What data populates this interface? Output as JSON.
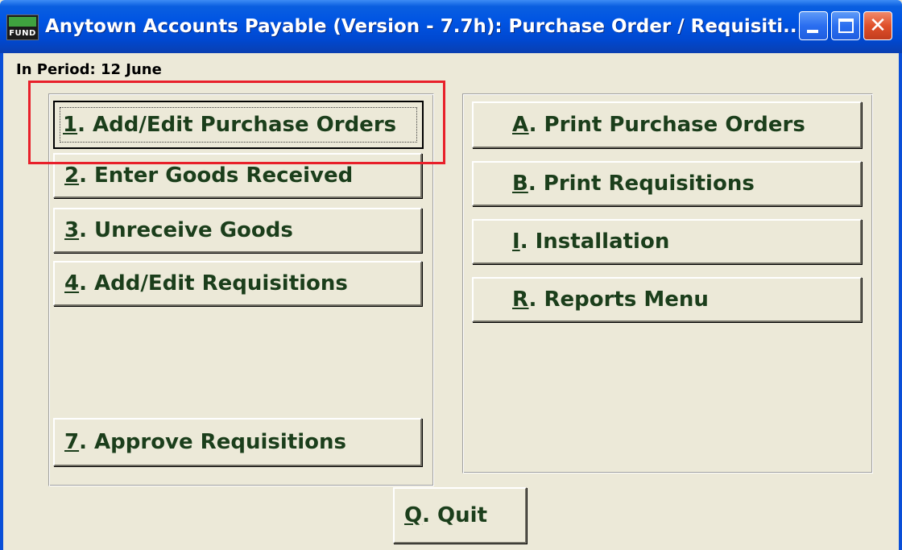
{
  "window": {
    "app_icon_top": "",
    "app_icon_bottom": "FUND",
    "title": "Anytown Accounts Payable (Version - 7.7h):  Purchase Order / Requisiti...",
    "controls": {
      "minimize": "minimize-icon",
      "maximize": "maximize-icon",
      "close": "close-icon",
      "close_glyph": "✕"
    },
    "titlebar_color": "#0054e3",
    "close_color": "#e0502a"
  },
  "period": {
    "text": "In Period: 12 June"
  },
  "left_menu": [
    {
      "key": "1",
      "rest": ".  Add/Edit Purchase Orders"
    },
    {
      "key": "2",
      "rest": ". Enter Goods Received"
    },
    {
      "key": "3",
      "rest": ". Unreceive Goods"
    },
    {
      "key": "4",
      "rest": ". Add/Edit Requisitions"
    },
    {
      "key": "7",
      "rest": ". Approve Requisitions"
    }
  ],
  "right_menu": [
    {
      "key": "A",
      "rest": ".  Print Purchase Orders"
    },
    {
      "key": "B",
      "rest": ". Print Requisitions"
    },
    {
      "key": "I",
      "rest": ".  Installation"
    },
    {
      "key": "R",
      "rest": ". Reports Menu"
    }
  ],
  "quit": {
    "key": "Q",
    "rest": ".  Quit"
  },
  "colors": {
    "button_text": "#1b3e1b",
    "window_bg": "#ece9d8",
    "highlight": "#e8202a"
  }
}
